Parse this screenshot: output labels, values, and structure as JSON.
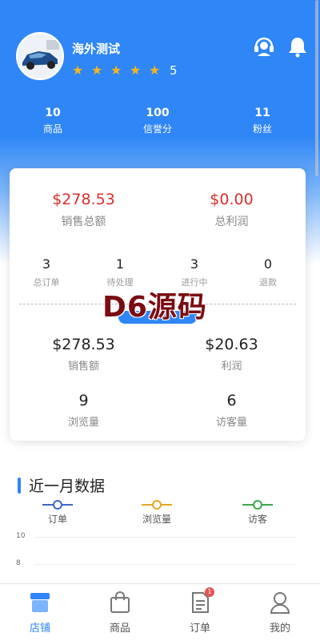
{
  "shop": {
    "name": "海外测试",
    "rating": 5,
    "rating_label": "5"
  },
  "header_icons": [
    "customer-service-icon",
    "bell-icon"
  ],
  "stats": [
    {
      "value": "10",
      "label": "商品"
    },
    {
      "value": "100",
      "label": "信誉分"
    },
    {
      "value": "11",
      "label": "粉丝"
    }
  ],
  "summary": {
    "sales_total": {
      "value": "$278.53",
      "label": "销售总额"
    },
    "profit_total": {
      "value": "$0.00",
      "label": "总利润"
    },
    "orders": [
      {
        "value": "3",
        "label": "总订单"
      },
      {
        "value": "1",
        "label": "待处理"
      },
      {
        "value": "3",
        "label": "进行中"
      },
      {
        "value": "0",
        "label": "退款"
      }
    ],
    "metrics": [
      {
        "value": "$278.53",
        "label": "销售额"
      },
      {
        "value": "$20.63",
        "label": "利润"
      },
      {
        "value": "9",
        "label": "浏览量"
      },
      {
        "value": "6",
        "label": "访客量"
      }
    ]
  },
  "watermark": "D6源码",
  "chart": {
    "title": "近一月数据",
    "legend": [
      {
        "name": "订单",
        "color": "#3d6bc4"
      },
      {
        "name": "浏览量",
        "color": "#e4a824"
      },
      {
        "name": "访客",
        "color": "#3aa94a"
      }
    ],
    "y_ticks": [
      "10",
      "8"
    ]
  },
  "tabbar": {
    "tabs": [
      {
        "label": "店铺",
        "icon": "shop-icon",
        "active": true
      },
      {
        "label": "商品",
        "icon": "bag-icon",
        "active": false
      },
      {
        "label": "订单",
        "icon": "order-icon",
        "active": false,
        "badge": "1"
      },
      {
        "label": "我的",
        "icon": "user-icon",
        "active": false
      }
    ]
  },
  "colors": {
    "primary": "#2f86f6",
    "accent_red": "#d8302d",
    "star": "#f7b51c"
  }
}
